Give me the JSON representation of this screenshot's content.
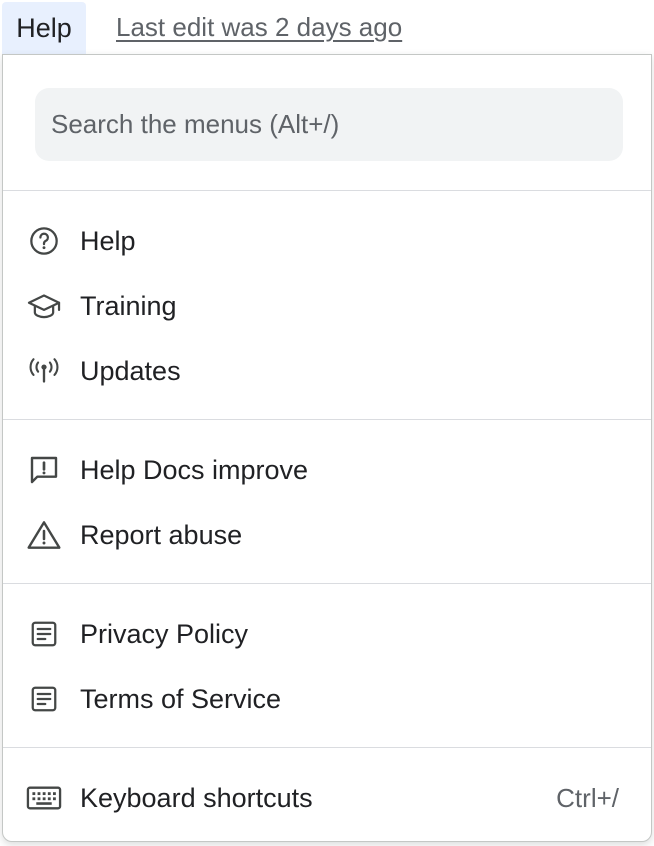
{
  "menubar": {
    "help_label": "Help",
    "last_edit": "Last edit was 2 days ago"
  },
  "search": {
    "placeholder": "Search the menus (Alt+/)"
  },
  "groups": [
    {
      "items": [
        {
          "label": "Help",
          "icon": "help-circle-icon"
        },
        {
          "label": "Training",
          "icon": "graduation-cap-icon"
        },
        {
          "label": "Updates",
          "icon": "broadcast-icon"
        }
      ]
    },
    {
      "items": [
        {
          "label": "Help Docs improve",
          "icon": "feedback-icon"
        },
        {
          "label": "Report abuse",
          "icon": "warning-icon"
        }
      ]
    },
    {
      "items": [
        {
          "label": "Privacy Policy",
          "icon": "document-icon"
        },
        {
          "label": "Terms of Service",
          "icon": "document-icon"
        }
      ]
    },
    {
      "items": [
        {
          "label": "Keyboard shortcuts",
          "icon": "keyboard-icon",
          "shortcut": "Ctrl+/"
        }
      ]
    }
  ],
  "colors": {
    "menu_tab_highlight": "#e8f0fe",
    "search_background": "#f1f3f4",
    "divider": "#dadce0",
    "text_primary": "#202124",
    "text_secondary": "#5f6368"
  }
}
